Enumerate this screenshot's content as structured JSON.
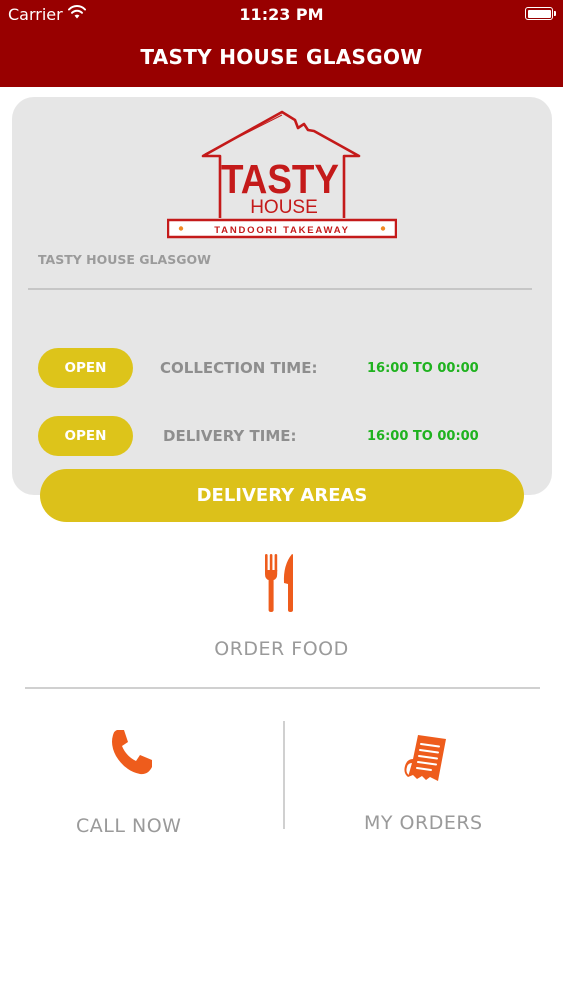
{
  "status_bar": {
    "carrier": "Carrier",
    "time": "11:23 PM"
  },
  "header": {
    "title": "TASTY HOUSE GLASGOW"
  },
  "logo": {
    "line1": "TASTY",
    "line2": "HOUSE",
    "tagline": "TANDOORI TAKEAWAY"
  },
  "store": {
    "name": "TASTY HOUSE GLASGOW"
  },
  "schedule": [
    {
      "status": "OPEN",
      "label": "COLLECTION TIME:",
      "hours": "16:00 TO 00:00"
    },
    {
      "status": "OPEN",
      "label": "DELIVERY TIME:",
      "hours": "16:00 TO 00:00"
    }
  ],
  "delivery_areas_label": "DELIVERY AREAS",
  "menu": {
    "order_food": "ORDER FOOD",
    "call_now": "CALL NOW",
    "my_orders": "MY ORDERS"
  },
  "colors": {
    "header_bg": "#980000",
    "accent_yellow": "#ddc41a",
    "hours_green": "#1fb21f",
    "icon_orange": "#ee5c1c",
    "logo_red": "#c41a1a"
  },
  "icons": {
    "wifi": "wifi-icon",
    "battery": "battery-icon",
    "order_food": "fork-knife-icon",
    "call_now": "phone-icon",
    "my_orders": "receipt-icon"
  }
}
